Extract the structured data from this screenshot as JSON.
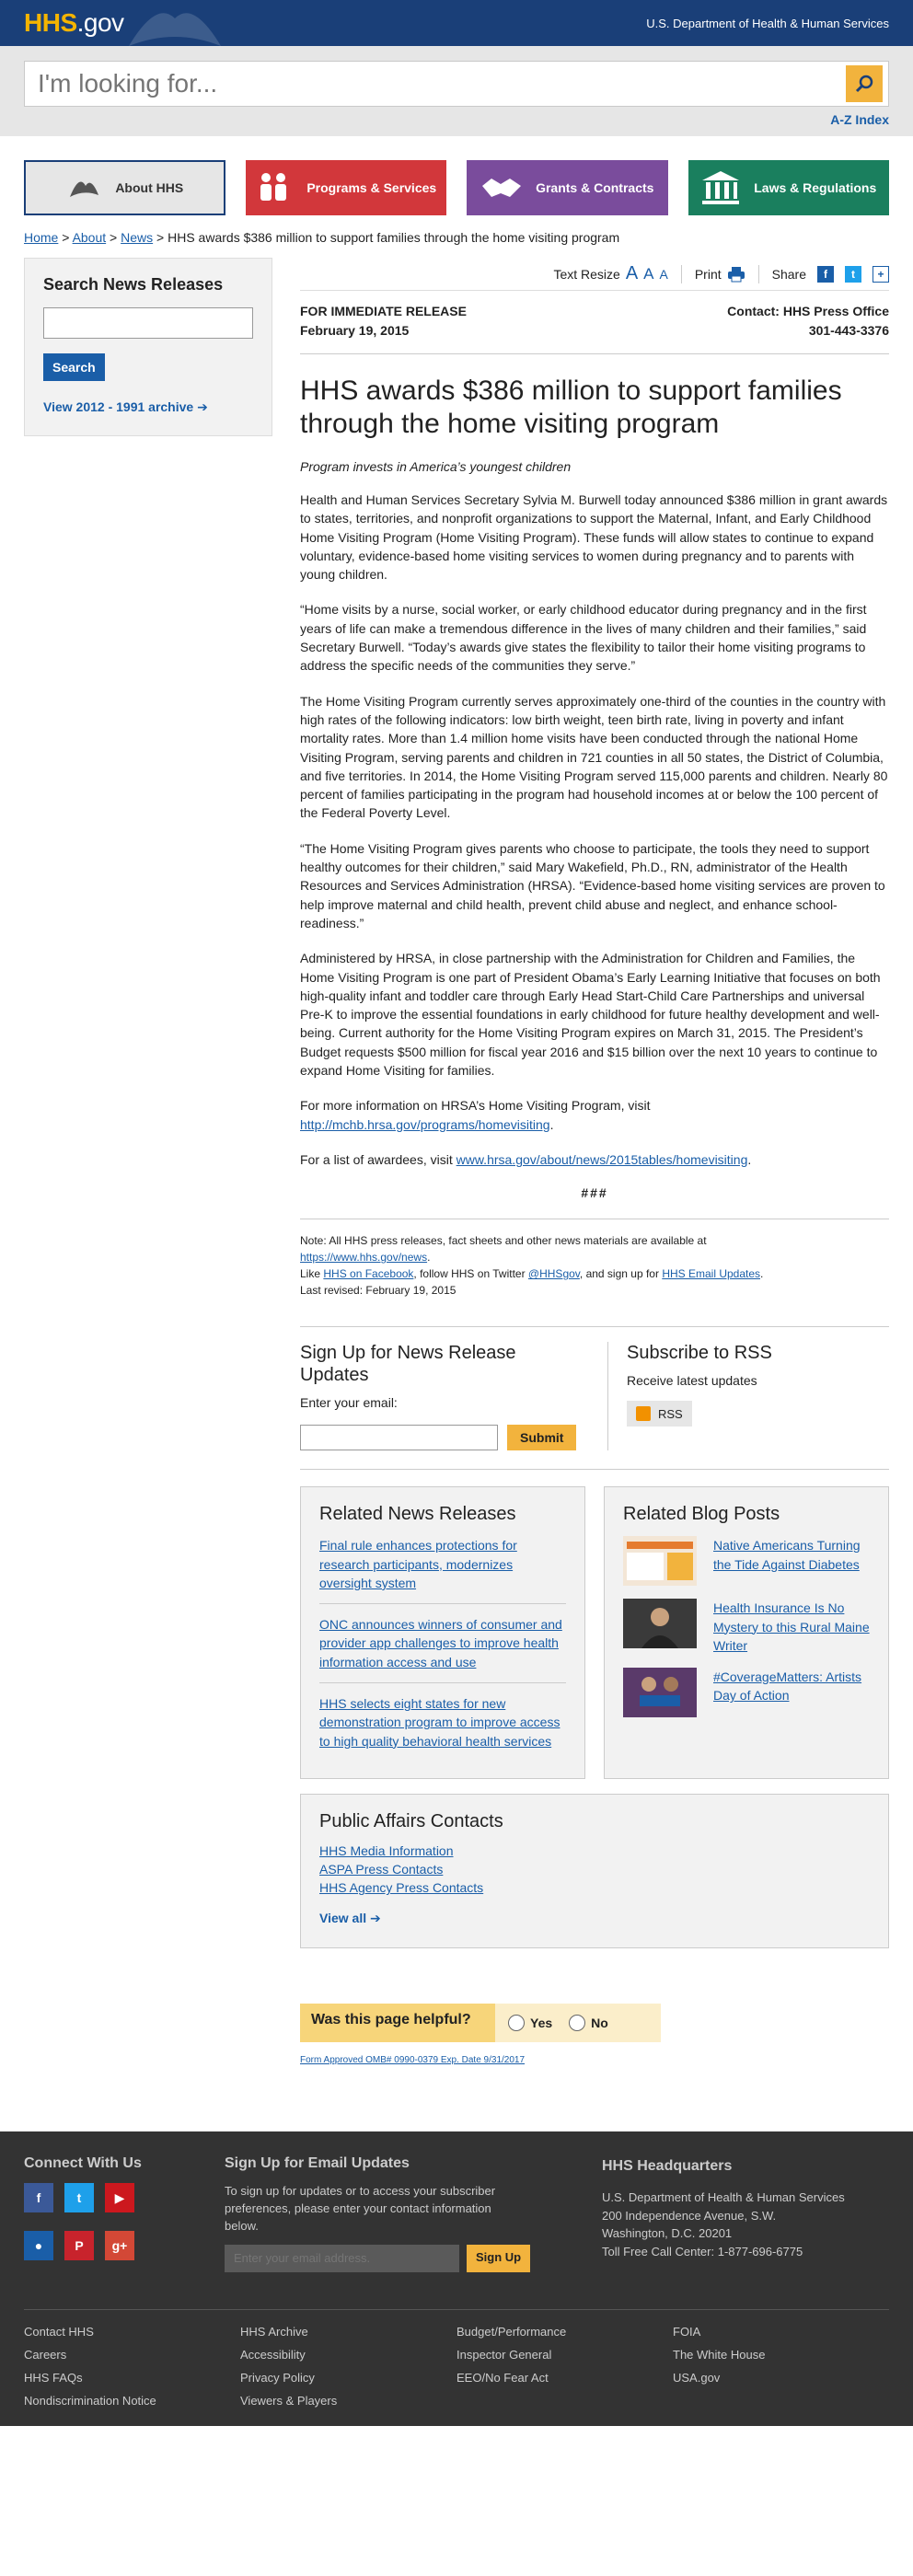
{
  "header": {
    "logo_main": "HHS",
    "logo_suffix": ".gov",
    "dept": "U.S. Department of Health & Human Services"
  },
  "search": {
    "placeholder": "I'm looking for...",
    "az_link": "A-Z Index"
  },
  "nav": {
    "about": "About HHS",
    "programs": "Programs & Services",
    "grants": "Grants & Contracts",
    "laws": "Laws & Regulations"
  },
  "breadcrumb": {
    "home": "Home",
    "about": "About",
    "news": "News",
    "sep": ">",
    "current": "HHS awards $386 million to support families through the home visiting program"
  },
  "sidebar": {
    "title": "Search News Releases",
    "button": "Search",
    "archive_link": "View 2012 - 1991 archive"
  },
  "tools": {
    "text_resize": "Text Resize",
    "a_letter": "A",
    "print": "Print",
    "share": "Share"
  },
  "release": {
    "for_release": "FOR IMMEDIATE RELEASE",
    "date": "February 19, 2015",
    "contact": "Contact: HHS Press Office",
    "phone": "301-443-3376"
  },
  "article": {
    "title": "HHS awards $386 million to support families through the home visiting program",
    "subtitle": "Program invests in America’s youngest children",
    "p1": "Health and Human Services Secretary Sylvia M. Burwell today announced $386 million in grant awards to states, territories, and nonprofit organizations to support the Maternal, Infant, and Early Childhood Home Visiting Program (Home Visiting Program). These funds will allow states to continue to expand voluntary, evidence-based home visiting services to women during pregnancy and to parents with young children.",
    "p2": "“Home visits by a nurse, social worker, or early childhood educator during pregnancy and in the first years of life can make a tremendous difference in the lives of many children and their families,” said Secretary Burwell. “Today’s awards give states the flexibility to tailor their home visiting programs to address the specific needs of the communities they serve.”",
    "p3": "The Home Visiting Program currently serves approximately one-third of the counties in the country with high rates of the following indicators: low birth weight, teen birth rate, living in poverty and infant mortality rates. More than 1.4 million home visits have been conducted through the national Home Visiting Program, serving parents and children in 721 counties in all 50 states, the District of Columbia, and five territories. In 2014, the Home Visiting Program served 115,000 parents and children. Nearly 80 percent of families participating in the program had household incomes at or below the 100 percent of the Federal Poverty Level.",
    "p4": "“The Home Visiting Program gives parents who choose to participate, the tools they need to support healthy outcomes for their children,” said Mary Wakefield, Ph.D., RN, administrator of the Health Resources and Services Administration (HRSA). “Evidence-based home visiting services are proven to help improve maternal and child health, prevent child abuse and neglect, and enhance school-readiness.”",
    "p5": "Administered by HRSA, in close partnership with the Administration for Children and Families, the Home Visiting Program is one part of President Obama’s Early Learning Initiative that focuses on both high-quality infant and toddler care through Early Head Start-Child Care Partnerships and universal Pre-K to improve the essential foundations in early childhood for future healthy development and well-being. Current authority for the Home Visiting Program expires on March 31, 2015. The President’s Budget requests $500 million for fiscal year 2016 and $15 billion over the next 10 years to continue to expand Home Visiting for families.",
    "p6_text": "For more information on HRSA’s Home Visiting Program, visit",
    "p6_link": "http://mchb.hrsa.gov/programs/homevisiting",
    "p7_text": "For a list of awardees, visit",
    "p7_link": "www.hrsa.gov/about/news/2015tables/homevisiting",
    "period": ".",
    "hashes": "###"
  },
  "note": {
    "line1": "Note: All HHS press releases, fact sheets and other news materials are available at",
    "news_link": "https://www.hhs.gov/news",
    "like": "Like",
    "fb_link": "HHS on Facebook",
    "follow": ", follow HHS on Twitter",
    "tw_link": "@HHSgov",
    "signup": ", and sign up for",
    "email_link": "HHS Email Updates",
    "revised": "Last revised: February 19, 2015"
  },
  "signup": {
    "title": "Sign Up for News Release Updates",
    "label": "Enter your email:",
    "button": "Submit",
    "rss_title": "Subscribe to RSS",
    "rss_sub": "Receive latest updates",
    "rss_button": "RSS"
  },
  "related_news": {
    "title": "Related News Releases",
    "items": [
      "Final rule enhances protections for research participants, modernizes oversight system",
      "ONC announces winners of consumer and provider app challenges to improve health information access and use",
      "HHS selects eight states for new demonstration program to improve access to high quality behavioral health services"
    ]
  },
  "related_blog": {
    "title": "Related Blog Posts",
    "items": [
      "Native Americans Turning the Tide Against Diabetes",
      "Health Insurance Is No Mystery to this Rural Maine Writer",
      "#CoverageMatters: Artists Day of Action"
    ]
  },
  "contacts": {
    "title": "Public Affairs Contacts",
    "links": [
      "HHS Media Information",
      "ASPA Press Contacts",
      "HHS Agency Press Contacts"
    ],
    "view_all": "View all"
  },
  "helpful": {
    "question": "Was this page helpful?",
    "yes": "Yes",
    "no": "No",
    "omb": "Form Approved OMB# 0990-0379 Exp. Date 9/31/2017"
  },
  "footer": {
    "connect": "Connect With Us",
    "signup_title": "Sign Up for Email Updates",
    "signup_text": "To sign up for updates or to access your subscriber preferences, please enter your contact information below.",
    "email_placeholder": "Enter your email address.",
    "signup_btn": "Sign Up",
    "hq_title": "HHS Headquarters",
    "hq_line1": "U.S. Department of Health & Human Services",
    "hq_line2": "200 Independence Avenue, S.W.",
    "hq_line3": "Washington, D.C. 20201",
    "hq_line4": "Toll Free Call Center: 1-877-696-6775",
    "links": [
      "Contact HHS",
      "HHS Archive",
      "Budget/Performance",
      "FOIA",
      "Careers",
      "Accessibility",
      "Inspector General",
      "The White House",
      "HHS FAQs",
      "Privacy Policy",
      "EEO/No Fear Act",
      "USA.gov",
      "Nondiscrimination Notice",
      "Viewers & Players"
    ]
  },
  "colors": {
    "brand_navy": "#1a3f78",
    "link_blue": "#1a5ea8",
    "gold": "#f2b33d",
    "programs_red": "#d2373b",
    "grants_purple": "#7a4c9c",
    "laws_green": "#1a7f5e"
  }
}
